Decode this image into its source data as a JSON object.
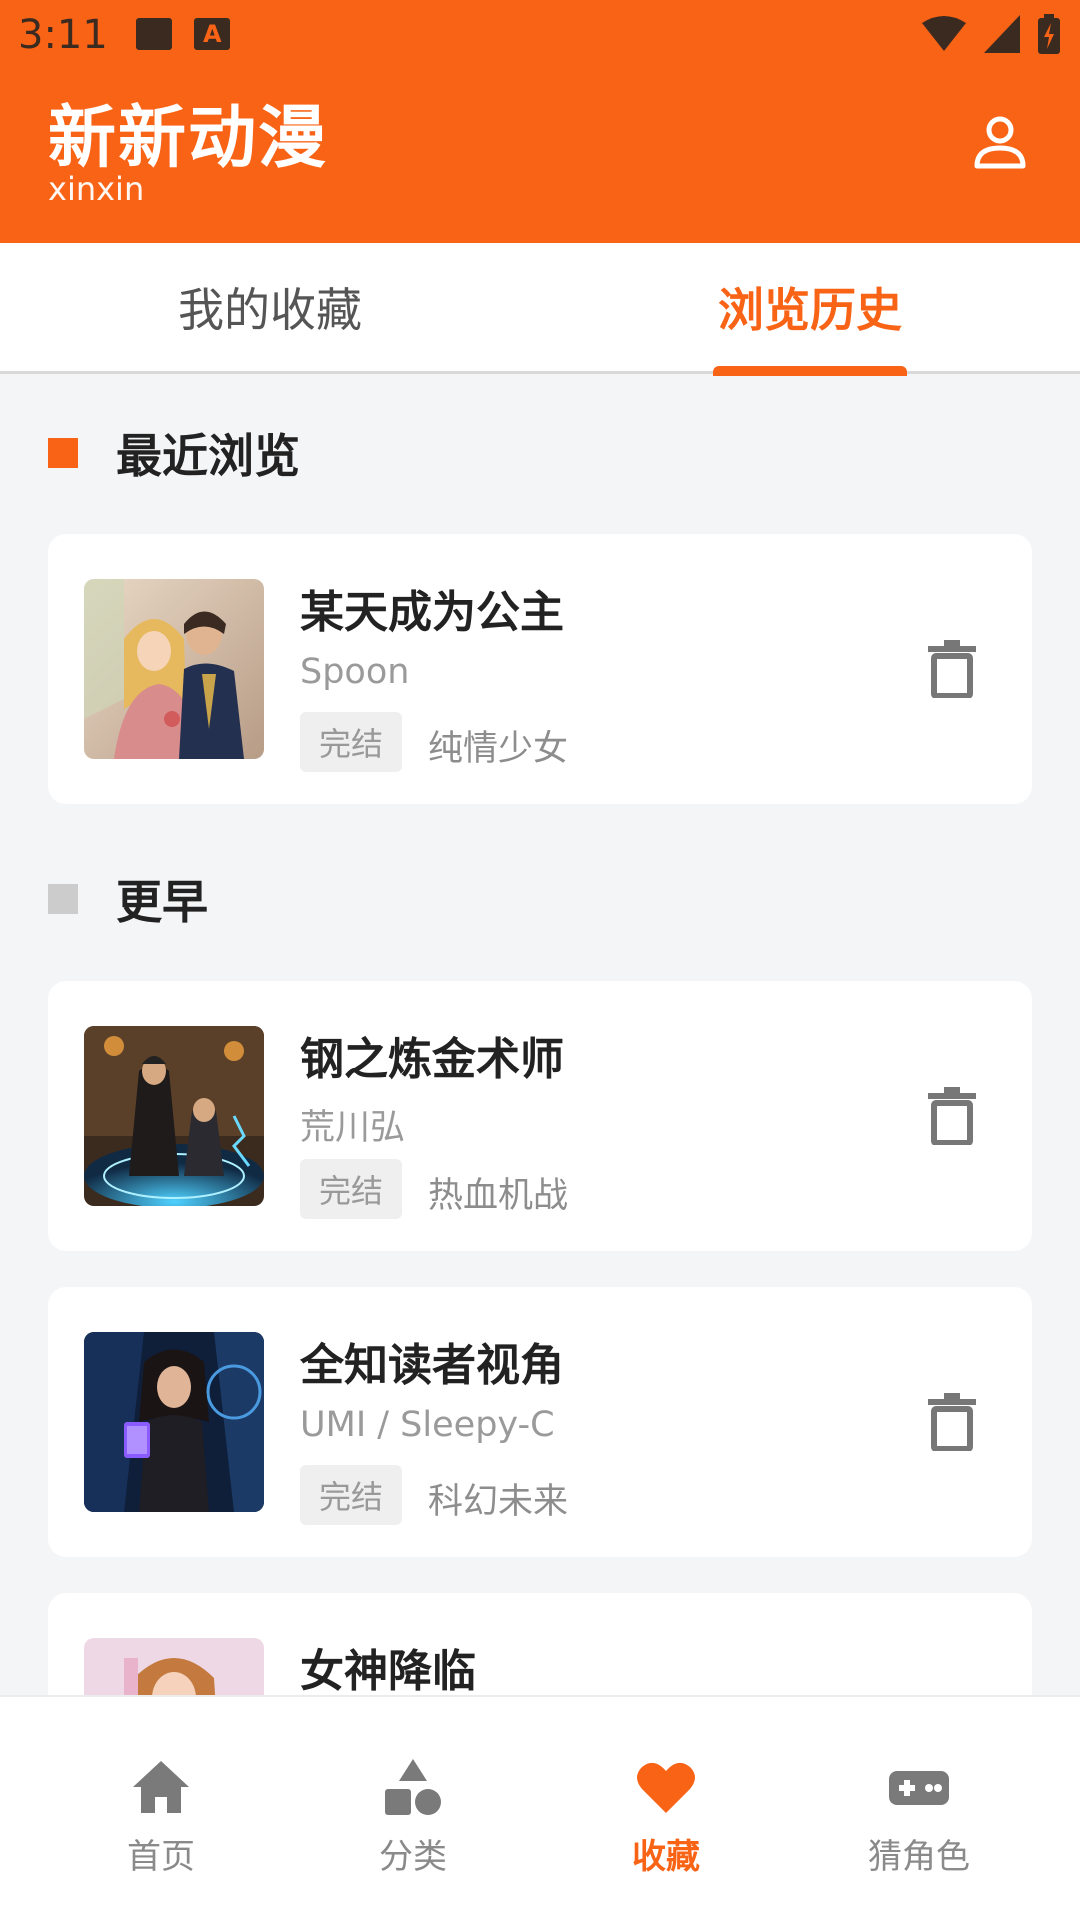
{
  "status_bar": {
    "time": "3:11"
  },
  "header": {
    "title": "新新动漫",
    "subtitle": "xinxin"
  },
  "tabs": [
    {
      "label": "我的收藏",
      "active": false
    },
    {
      "label": "浏览历史",
      "active": true
    }
  ],
  "sections": {
    "recent": {
      "title": "最近浏览"
    },
    "earlier": {
      "title": "更早"
    }
  },
  "items": [
    {
      "title": "某天成为公主",
      "author": "Spoon",
      "status": "完结",
      "genre": "纯情少女"
    },
    {
      "title": "钢之炼金术师",
      "author": "荒川弘",
      "status": "完结",
      "genre": "热血机战"
    },
    {
      "title": "全知读者视角",
      "author": "UMI / Sleepy-C",
      "status": "完结",
      "genre": "科幻未来"
    },
    {
      "title": "女神降临"
    }
  ],
  "bottom_nav": [
    {
      "label": "首页",
      "icon": "home-icon"
    },
    {
      "label": "分类",
      "icon": "category-icon"
    },
    {
      "label": "收藏",
      "icon": "heart-icon",
      "active": true
    },
    {
      "label": "猜角色",
      "icon": "gamepad-icon"
    }
  ],
  "colors": {
    "accent": "#f96316",
    "marker_inactive": "#cccccc",
    "background": "#f4f5f7"
  }
}
